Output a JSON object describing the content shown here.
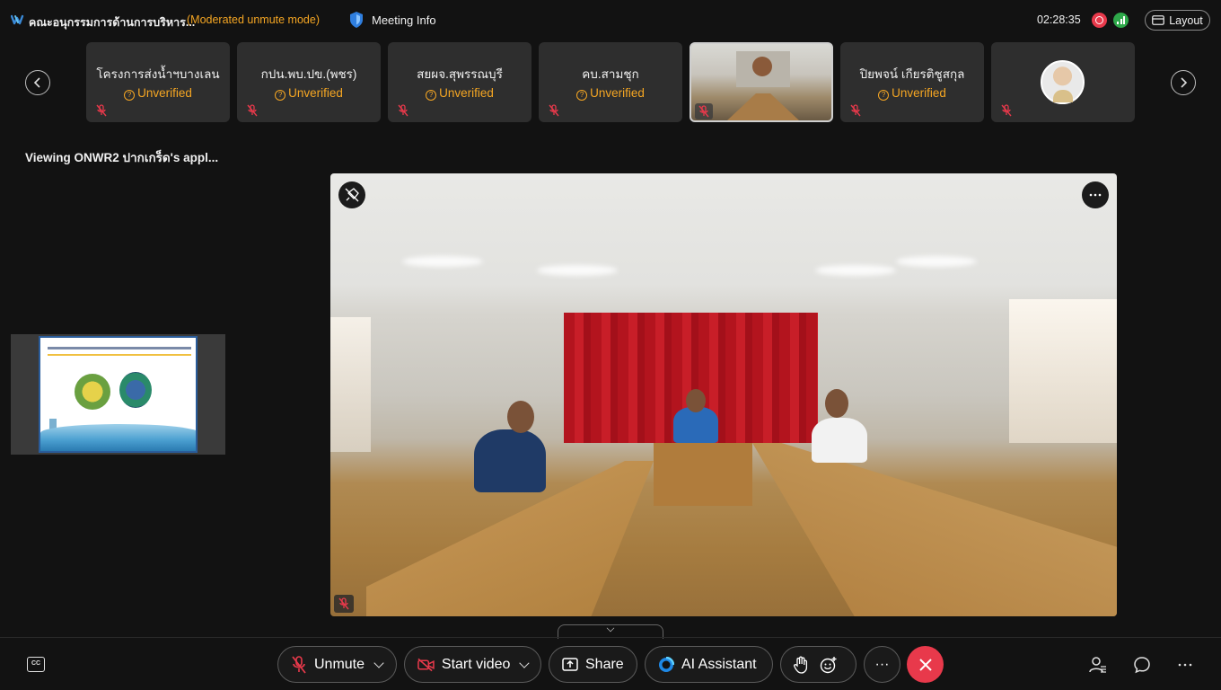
{
  "titlebar": {
    "meeting_title": "คณะอนุกรรมการด้านการบริหาร...",
    "mode": "(Moderated unmute mode)",
    "meeting_info_label": "Meeting Info",
    "clock": "02:28:35",
    "layout_label": "Layout"
  },
  "strip": {
    "tiles": [
      {
        "name": "โครงการส่งน้ำฯบางเลน",
        "status": "Unverified"
      },
      {
        "name": "กปน.พบ.ปข.(พชร)",
        "status": "Unverified"
      },
      {
        "name": "สยผจ.สุพรรณบุรี",
        "status": "Unverified"
      },
      {
        "name": "คบ.สามชุก",
        "status": "Unverified"
      },
      {
        "name": "ปิยพจน์ เกียรติชูสกุล",
        "status": "Unverified"
      }
    ]
  },
  "viewing_label": "Viewing ONWR2 ปากเกร็ด's appl...",
  "bottombar": {
    "cc_label": "CC",
    "unmute_label": "Unmute",
    "start_video_label": "Start video",
    "share_label": "Share",
    "ai_assistant_label": "AI Assistant",
    "more_label": "···"
  },
  "colors": {
    "accent_warning": "#f5a623",
    "end_call": "#e8394b",
    "connection_good": "#2ea84a"
  }
}
